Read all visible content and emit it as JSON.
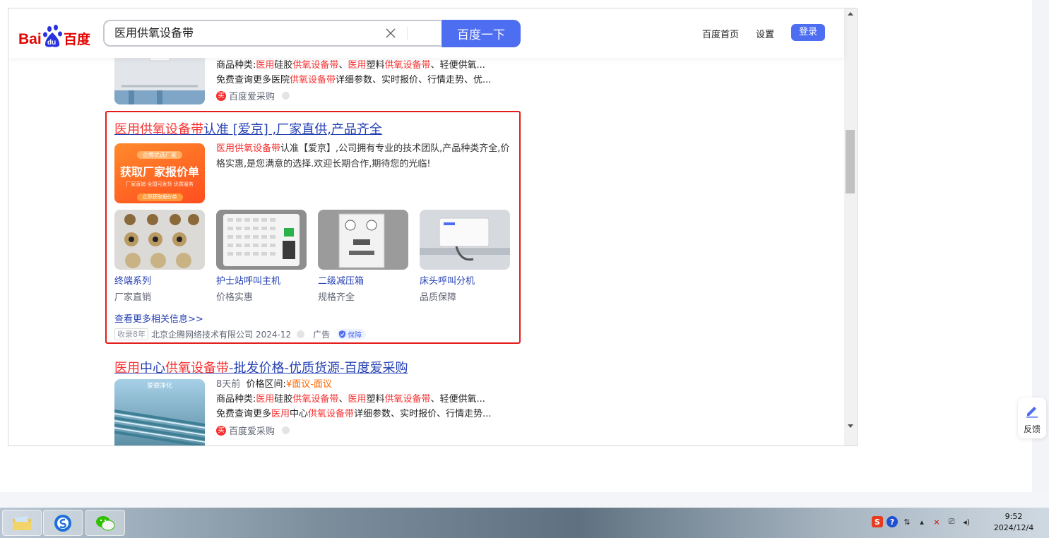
{
  "search": {
    "query": "医用供氧设备带",
    "button_label": "百度一下"
  },
  "header": {
    "links": [
      "百度首页",
      "设置"
    ],
    "login_label": "登录"
  },
  "result_top": {
    "line1": {
      "p1": "商品种类:",
      "r1": "医用",
      "p2": "硅胶",
      "r2": "供氧设备带",
      "p3": "、",
      "r3": "医用",
      "p4": "塑料",
      "r4": "供氧设备带",
      "p5": "、轻便供氧..."
    },
    "line2": {
      "p1": "免费查询更多医院",
      "r1": "供氧设备带",
      "p2": "详细参数、实时报价、行情走势、优..."
    },
    "source": "百度爱采购"
  },
  "ad": {
    "title_red": "医用供氧设备带",
    "title_rest": "认准 [爱京] ,厂家直供,产品齐全",
    "banner": {
      "top": "企腾优选厂家",
      "main": "获取厂家报价单",
      "sub": "厂家直销 全国可发货 优质服务",
      "bottom": "立即获取报价单"
    },
    "desc_red": "医用供氧设备带",
    "desc_rest": "认准【爱京】,公司拥有专业的技术团队,产品种类齐全,价格实惠,是您满意的选择.欢迎长期合作,期待您的光临!",
    "products": [
      {
        "name": "终端系列",
        "sub": "厂家直销"
      },
      {
        "name": "护士站呼叫主机",
        "sub": "价格实惠"
      },
      {
        "name": "二级减压箱",
        "sub": "规格齐全"
      },
      {
        "name": "床头呼叫分机",
        "sub": "品质保障"
      }
    ],
    "more_link": "查看更多相关信息>>",
    "footer": {
      "tag": "收录8年",
      "company": "北京企腾网络技术有限公司",
      "date": "2024-12",
      "ad_label": "广告",
      "badge": "保障"
    }
  },
  "result3": {
    "title": {
      "r1": "医用",
      "b1": "中心",
      "r2": "供氧设备带",
      "b2": "-批发价格-优质货源-百度爱采购"
    },
    "image_caption": "爱德净化",
    "meta": {
      "age": "8天前",
      "price_label": "价格区间:",
      "price_value": "¥面议-面议"
    },
    "line1": {
      "p1": "商品种类:",
      "r1": "医用",
      "p2": "硅胶",
      "r2": "供氧设备带",
      "p3": "、",
      "r3": "医用",
      "p4": "塑料",
      "r4": "供氧设备带",
      "p5": "、轻便供氧..."
    },
    "line2": {
      "p1": "免费查询更多",
      "r1": "医用",
      "p2": "中心",
      "r2": "供氧设备带",
      "p3": "详细参数、实时报价、行情走势..."
    },
    "source": "百度爱采购"
  },
  "feedback_label": "反馈",
  "taskbar": {
    "time": "9:52",
    "date": "2024/12/4"
  },
  "colors": {
    "accent": "#4e6ef2",
    "highlight_red": "#f73131",
    "link_blue": "#2440b3",
    "box_border": "#e31b1b"
  }
}
